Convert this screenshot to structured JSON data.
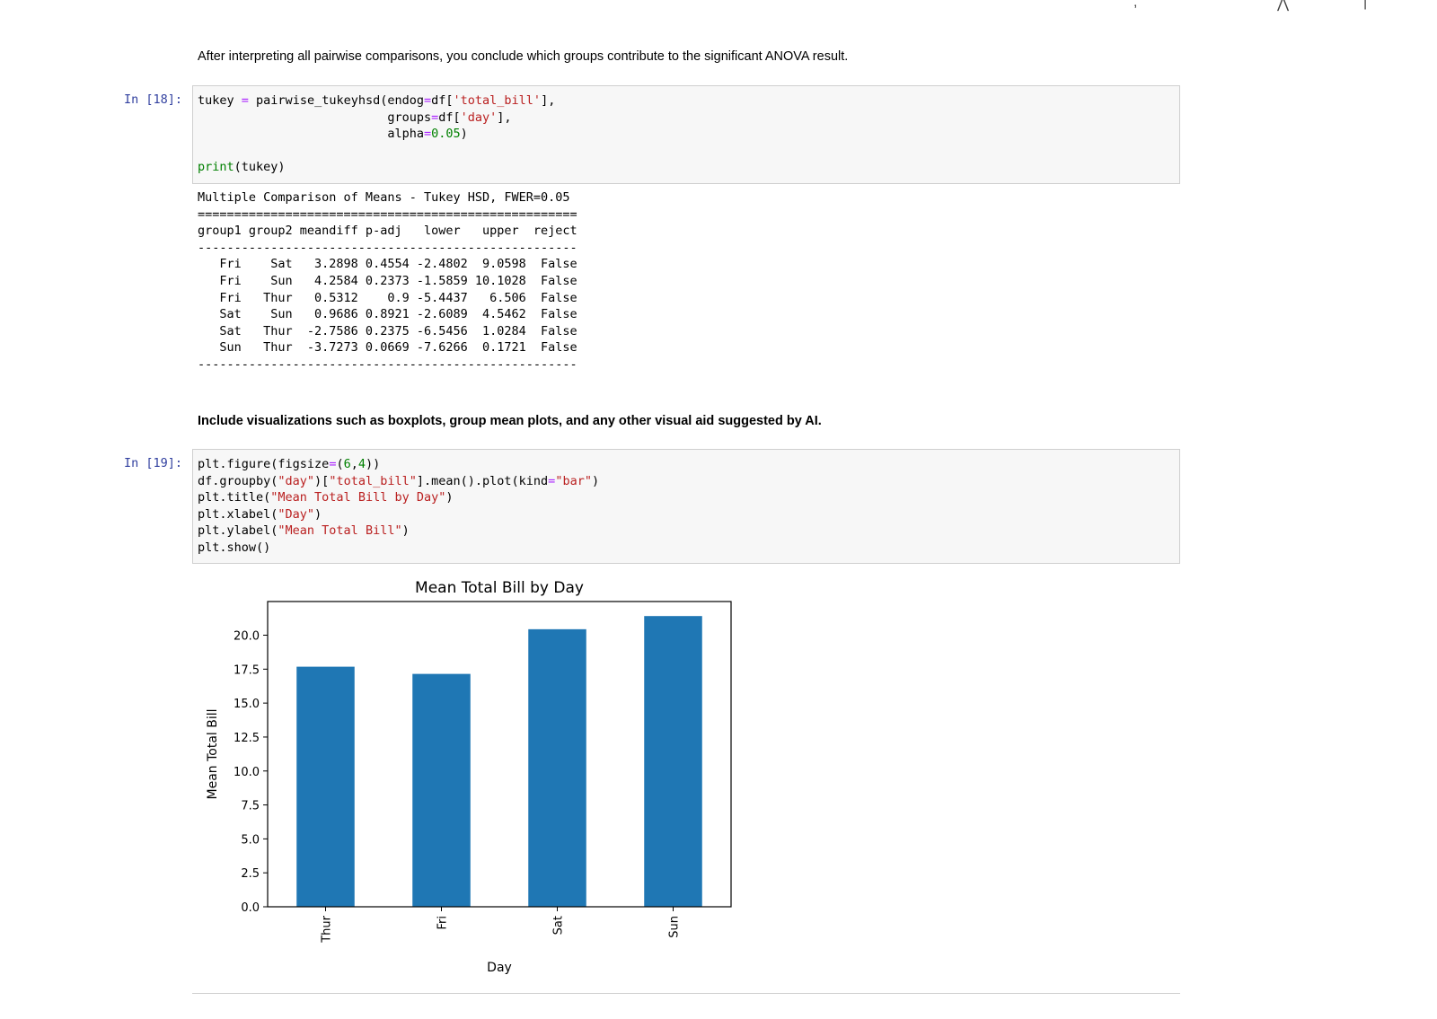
{
  "markdown_1": "After interpreting all pairwise comparisons, you conclude which groups contribute to the significant ANOVA result.",
  "cell_18": {
    "prompt": "In [18]:",
    "lines": [
      "tukey = pairwise_tukeyhsd(endog=df['total_bill'],",
      "                          groups=df['day'],",
      "                          alpha=0.05)",
      "",
      "print(tukey)"
    ]
  },
  "output_18": {
    "title": "Multiple Comparison of Means - Tukey HSD, FWER=0.05",
    "rule_double": "====================================================",
    "header": "group1 group2 meandiff p-adj   lower   upper  reject",
    "rule_single": "----------------------------------------------------",
    "columns": [
      "group1",
      "group2",
      "meandiff",
      "p-adj",
      "lower",
      "upper",
      "reject"
    ],
    "rows": [
      [
        "Fri",
        "Sat",
        "3.2898",
        "0.4554",
        "-2.4802",
        "9.0598",
        "False"
      ],
      [
        "Fri",
        "Sun",
        "4.2584",
        "0.2373",
        "-1.5859",
        "10.1028",
        "False"
      ],
      [
        "Fri",
        "Thur",
        "0.5312",
        "0.9",
        "-5.4437",
        "6.506",
        "False"
      ],
      [
        "Sat",
        "Sun",
        "0.9686",
        "0.8921",
        "-2.6089",
        "4.5462",
        "False"
      ],
      [
        "Sat",
        "Thur",
        "-2.7586",
        "0.2375",
        "-6.5456",
        "1.0284",
        "False"
      ],
      [
        "Sun",
        "Thur",
        "-3.7273",
        "0.0669",
        "-7.6266",
        "0.1721",
        "False"
      ]
    ]
  },
  "markdown_2": "Include visualizations such as boxplots, group mean plots, and any other visual aid suggested by AI.",
  "cell_19": {
    "prompt": "In [19]:",
    "lines": [
      "plt.figure(figsize=(6,4))",
      "df.groupby(\"day\")[\"total_bill\"].mean().plot(kind=\"bar\")",
      "plt.title(\"Mean Total Bill by Day\")",
      "plt.xlabel(\"Day\")",
      "plt.ylabel(\"Mean Total Bill\")",
      "plt.show()"
    ]
  },
  "colors": {
    "bar": "#1f77b4",
    "prompt": "#303f9f",
    "string": "#ba2121",
    "keyword": "#008000"
  },
  "chart_data": {
    "type": "bar",
    "title": "Mean Total Bill by Day",
    "xlabel": "Day",
    "ylabel": "Mean Total Bill",
    "categories": [
      "Thur",
      "Fri",
      "Sat",
      "Sun"
    ],
    "values": [
      17.68,
      17.15,
      20.44,
      21.41
    ],
    "ylim": [
      0,
      22.48
    ],
    "yticks": [
      "0.0",
      "2.5",
      "5.0",
      "7.5",
      "10.0",
      "12.5",
      "15.0",
      "17.5",
      "20.0"
    ],
    "grid": false
  }
}
